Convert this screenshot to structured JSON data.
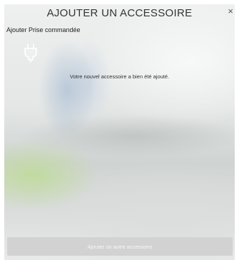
{
  "dialog": {
    "title": "AJOUTER UN ACCESSOIRE",
    "close_label": "×",
    "subtitle": "Ajouter Prise commandée",
    "accessory_icon": "plug-icon",
    "message": "Votre nouvel accessoire a bien été ajouté.",
    "add_another_label": "Ajouter un autre accessoire"
  },
  "colors": {
    "button_bg": "#d2d2d2",
    "button_text": "#f7f7f7",
    "title_text": "#333333"
  }
}
